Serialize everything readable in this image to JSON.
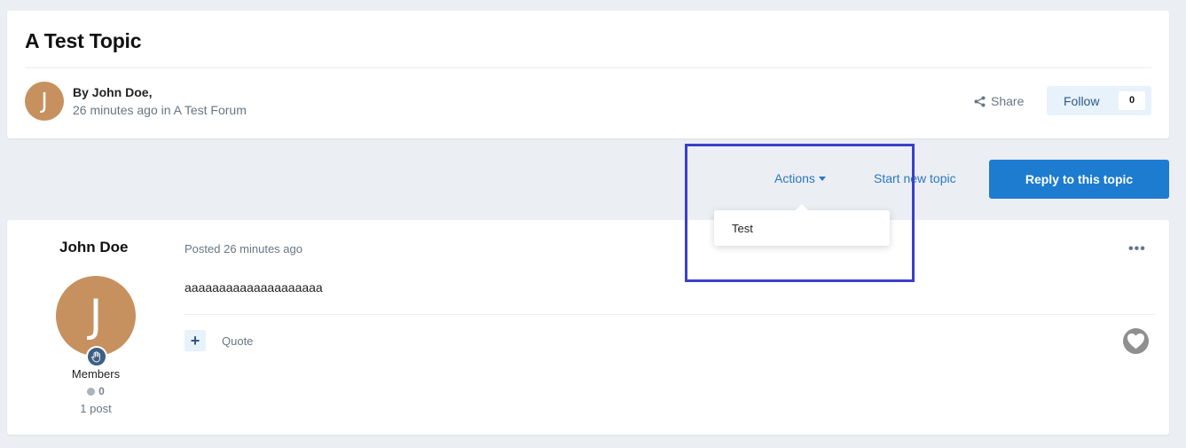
{
  "topic": {
    "title": "A Test Topic",
    "author_line": "By John Doe,",
    "time_ago": "26 minutes ago in",
    "forum": "A Test Forum",
    "avatar_letter": "J",
    "share_label": "Share",
    "follow_label": "Follow",
    "follow_count": "0"
  },
  "toolbar": {
    "actions_label": "Actions",
    "start_topic_label": "Start new topic",
    "reply_label": "Reply to this topic"
  },
  "actions_menu": {
    "items": [
      {
        "label": "Test"
      }
    ]
  },
  "post": {
    "author_name": "John Doe",
    "avatar_letter": "J",
    "group": "Members",
    "reputation": "0",
    "post_count": "1 post",
    "posted": "Posted 26 minutes ago",
    "body": "aaaaaaaaaaaaaaaaaaaa",
    "multiquote": "+",
    "quote_label": "Quote",
    "menu_icon": "ellipsis-icon",
    "reaction_icon": "heart-icon"
  },
  "colors": {
    "accent": "#1d7ccf",
    "link": "#2b78bf",
    "avatar": "#c6915f",
    "highlight": "#3b3fc9"
  }
}
